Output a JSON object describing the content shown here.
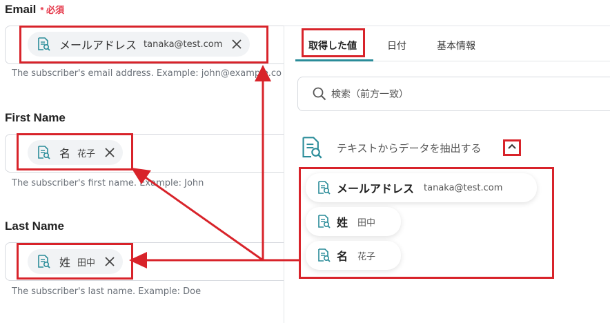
{
  "fields": {
    "email": {
      "label": "Email",
      "required_label": "* 必須",
      "chip_key": "メールアドレス",
      "chip_value": "tanaka@test.com",
      "hint": "The subscriber's email address. Example: john@example.com"
    },
    "first_name": {
      "label": "First Name",
      "chip_key": "名",
      "chip_value": "花子",
      "hint": "The subscriber's first name. Example: John"
    },
    "last_name": {
      "label": "Last Name",
      "chip_key": "姓",
      "chip_value": "田中",
      "hint": "The subscriber's last name. Example: Doe"
    }
  },
  "panel": {
    "tabs": [
      {
        "label": "取得した値",
        "active": true
      },
      {
        "label": "日付",
        "active": false
      },
      {
        "label": "基本情報",
        "active": false
      }
    ],
    "search_placeholder": "検索（前方一致）",
    "section_title": "テキストからデータを抽出する",
    "items": [
      {
        "key": "メールアドレス",
        "value": "tanaka@test.com"
      },
      {
        "key": "姓",
        "value": "田中"
      },
      {
        "key": "名",
        "value": "花子"
      }
    ]
  },
  "colors": {
    "accent": "#2a8c99",
    "annotation_red": "#d8232a",
    "required_red": "#e5384a"
  }
}
